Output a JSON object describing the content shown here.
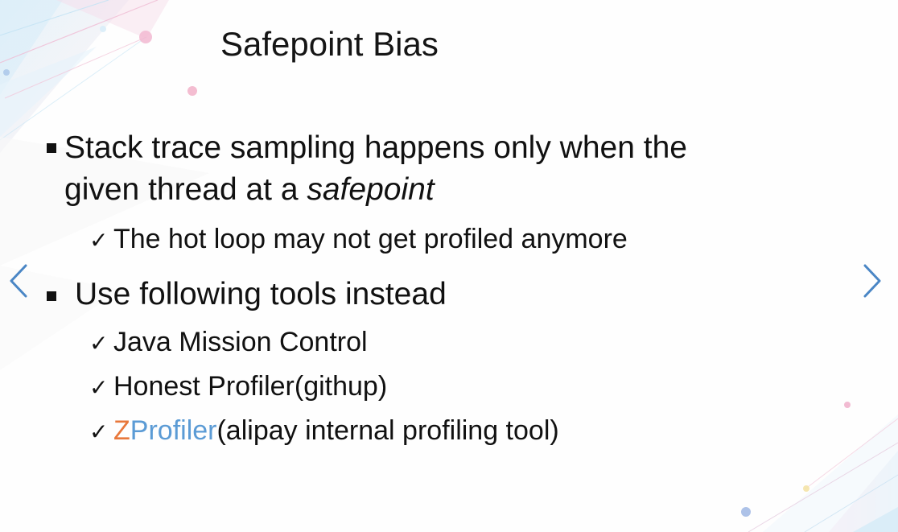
{
  "slide": {
    "title": "Safepoint Bias",
    "bullet1_line1": "Stack trace sampling happens only when the",
    "bullet1_line2_prefix": "given thread at a ",
    "bullet1_line2_italic": "safepoint",
    "sub1": "The hot loop may not get profiled anymore",
    "bullet2": "Use following tools instead",
    "sub2": "Java Mission Control",
    "sub3": "Honest Profiler(githup)",
    "sub4_z": "Z",
    "sub4_profiler": "Profiler",
    "sub4_rest": "(alipay internal profiling tool)",
    "check_mark": "✓"
  },
  "navigation": {
    "prev_icon": "chevron-left-icon",
    "next_icon": "chevron-right-icon"
  },
  "colors": {
    "z_orange": "#e8783b",
    "profiler_blue": "#5b9bd5",
    "nav_blue": "#4a86c5"
  }
}
